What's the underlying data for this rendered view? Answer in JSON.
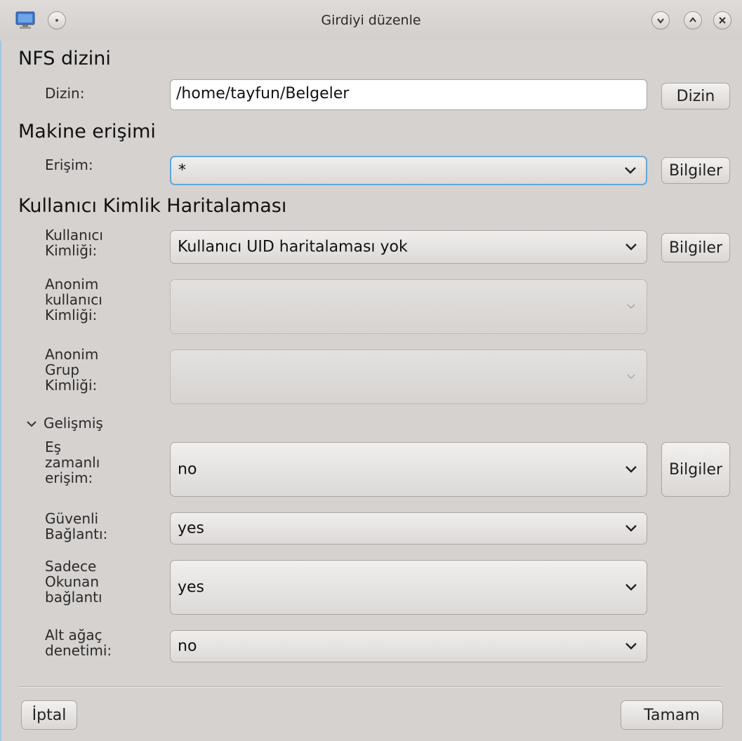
{
  "window": {
    "title": "Girdiyi düzenle"
  },
  "sections": {
    "nfs": "NFS dizini",
    "access": "Makine erişimi",
    "mapping": "Kullanıcı Kimlik Haritalaması"
  },
  "fields": {
    "dir_label": "Dizin:",
    "dir_value": "/home/tayfun/Belgeler",
    "dir_button": "Dizin",
    "access_label": "Erişim:",
    "access_value": "*",
    "info_button": "Bilgiler",
    "uid_label_1": "Kullanıcı",
    "uid_label_2": "Kimliği:",
    "uid_value": "Kullanıcı UID haritalaması yok",
    "anon_uid_label_1": "Anonim",
    "anon_uid_label_2": "kullanıcı",
    "anon_uid_label_3": "Kimliği:",
    "anon_gid_label_1": "Anonim",
    "anon_gid_label_2": "Grup",
    "anon_gid_label_3": "Kimliği:",
    "advanced": "Gelişmiş",
    "sync_label_1": "Eş",
    "sync_label_2": "zamanlı",
    "sync_label_3": "erişim:",
    "sync_value": "no",
    "secure_label_1": "Güvenli",
    "secure_label_2": "Bağlantı:",
    "secure_value": "yes",
    "ro_label_1": "Sadece",
    "ro_label_2": "Okunan",
    "ro_label_3": "bağlantı",
    "ro_value": "yes",
    "subtree_label_1": "Alt ağaç",
    "subtree_label_2": "denetimi:",
    "subtree_value": "no"
  },
  "footer": {
    "cancel": "İptal",
    "ok": "Tamam"
  },
  "icons": {
    "app": "monitor-icon",
    "menu": "window-menu-icon",
    "minimize": "chevron-down-icon",
    "maximize": "chevron-up-icon",
    "close": "close-icon",
    "dropdown": "chevron-down-icon"
  },
  "colors": {
    "focus": "#5fa8dc",
    "window_bg": "#d6d2d0"
  }
}
